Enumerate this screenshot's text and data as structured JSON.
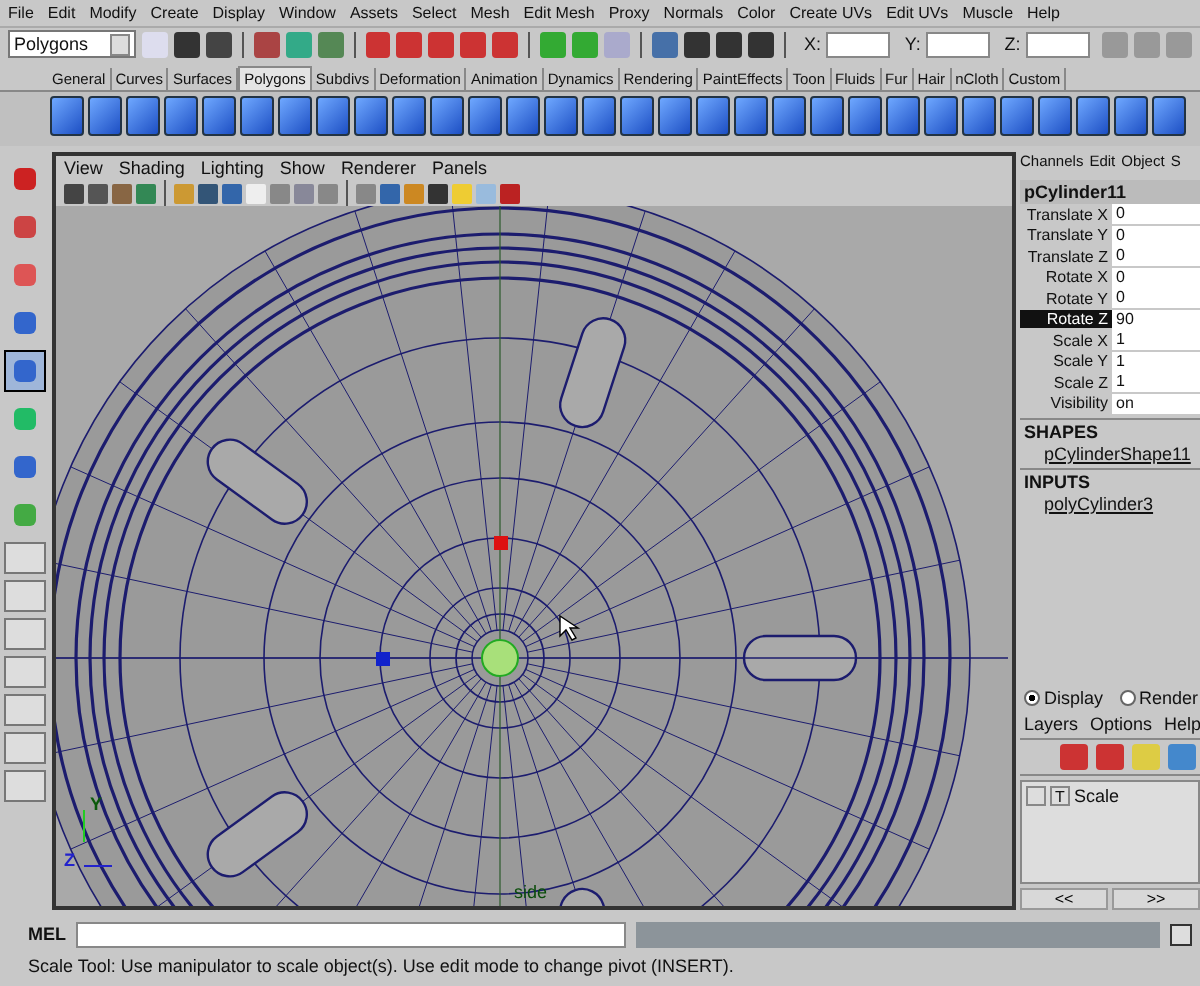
{
  "menu_bar": [
    "File",
    "Edit",
    "Modify",
    "Create",
    "Display",
    "Window",
    "Assets",
    "Select",
    "Mesh",
    "Edit Mesh",
    "Proxy",
    "Normals",
    "Color",
    "Create UVs",
    "Edit UVs",
    "Muscle",
    "Help"
  ],
  "status_line": {
    "mode_dropdown": "Polygons",
    "fields": [
      {
        "label": "X:"
      },
      {
        "label": "Y:"
      },
      {
        "label": "Z:"
      }
    ]
  },
  "shelf": {
    "tabs": [
      {
        "label": "General",
        "selected": false
      },
      {
        "label": "Curves",
        "selected": false
      },
      {
        "label": "Surfaces",
        "selected": false
      },
      {
        "label": "Polygons",
        "selected": true
      },
      {
        "label": "Subdivs",
        "selected": false
      },
      {
        "label": "Deformation",
        "selected": false
      },
      {
        "label": "Animation",
        "selected": false
      },
      {
        "label": "Dynamics",
        "selected": false
      },
      {
        "label": "Rendering",
        "selected": false
      },
      {
        "label": "PaintEffects",
        "selected": false
      },
      {
        "label": "Toon",
        "selected": false
      },
      {
        "label": "Fluids",
        "selected": false
      },
      {
        "label": "Fur",
        "selected": false
      },
      {
        "label": "Hair",
        "selected": false
      },
      {
        "label": "nCloth",
        "selected": false
      },
      {
        "label": "Custom",
        "selected": false
      }
    ]
  },
  "toolbox": {
    "tools": [
      {
        "selected": false
      },
      {
        "selected": false
      },
      {
        "selected": false
      },
      {
        "selected": false
      },
      {
        "selected": true
      },
      {
        "selected": false
      },
      {
        "selected": false
      },
      {
        "selected": false
      }
    ]
  },
  "viewport": {
    "menu": [
      "View",
      "Shading",
      "Lighting",
      "Show",
      "Renderer",
      "Panels"
    ],
    "axis_labels": [
      "Y",
      "Z"
    ],
    "camera_label": "side"
  },
  "channel_box": {
    "menu": [
      "Channels",
      "Edit",
      "Object",
      "S"
    ],
    "object_name": "pCylinder11",
    "attributes": [
      {
        "name": "Translate X",
        "value": "0",
        "selected": false
      },
      {
        "name": "Translate Y",
        "value": "0",
        "selected": false
      },
      {
        "name": "Translate Z",
        "value": "0",
        "selected": false
      },
      {
        "name": "Rotate X",
        "value": "0",
        "selected": false
      },
      {
        "name": "Rotate Y",
        "value": "0",
        "selected": false
      },
      {
        "name": "Rotate Z",
        "value": "90",
        "selected": true
      },
      {
        "name": "Scale X",
        "value": "1",
        "selected": false
      },
      {
        "name": "Scale Y",
        "value": "1",
        "selected": false
      },
      {
        "name": "Scale Z",
        "value": "1",
        "selected": false
      },
      {
        "name": "Visibility",
        "value": "on",
        "selected": false
      }
    ],
    "shapes_header": "SHAPES",
    "shape": "pCylinderShape11",
    "inputs_header": "INPUTS",
    "input": "polyCylinder3"
  },
  "layer_editor": {
    "modes": [
      {
        "label": "Display",
        "selected": true
      },
      {
        "label": "Render",
        "selected": false
      }
    ],
    "menu": [
      "Layers",
      "Options",
      "Help"
    ],
    "layers": [
      {
        "type": "T",
        "name": "Scale"
      }
    ],
    "nav_buttons": [
      "<<",
      ">>"
    ]
  },
  "command_line": {
    "label": "MEL"
  },
  "help_line": "Scale Tool: Use manipulator to scale object(s). Use edit mode to change pivot (INSERT)."
}
